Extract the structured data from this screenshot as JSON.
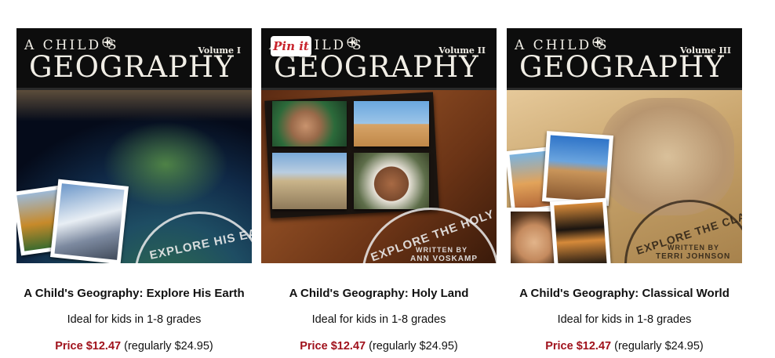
{
  "products": [
    {
      "cover_title_line1": "A CHILD'S",
      "cover_title_line2": "GEOGRAPHY",
      "volume": "Volume I",
      "stamp_text": "EXPLORE HIS EARTH",
      "title": "A Child's Geography: Explore His Earth",
      "subtitle": "Ideal for kids in 1-8 grades",
      "price": "Price $12.47",
      "regular": "(regularly $24.95)"
    },
    {
      "cover_title_line1": "A CHILD'S",
      "cover_title_line2": "GEOGRAPHY",
      "volume": "Volume II",
      "stamp_text": "EXPLORE THE HOLY L",
      "stamp_sub": "WRITTEN BY",
      "stamp_author": "ANN VOSKAMP",
      "title": "A Child's Geography: Holy Land",
      "subtitle": "Ideal for kids in 1-8 grades",
      "price": "Price $12.47",
      "regular": "(regularly $24.95)"
    },
    {
      "cover_title_line1": "A CHILD'S",
      "cover_title_line2": "GEOGRAPHY",
      "volume": "Volume III",
      "stamp_text": "EXPLORE THE CLASSICAL W",
      "stamp_sub": "WRITTEN BY",
      "stamp_author": "TERRI JOHNSON",
      "title": "A Child's Geography: Classical World",
      "subtitle": "Ideal for kids in 1-8 grades",
      "price": "Price $12.47",
      "regular": "(regularly $24.95)"
    }
  ],
  "pinit_label": "Pin it",
  "colors": {
    "price": "#a0121c",
    "banner": "#0d0d0d",
    "text": "#111111"
  }
}
